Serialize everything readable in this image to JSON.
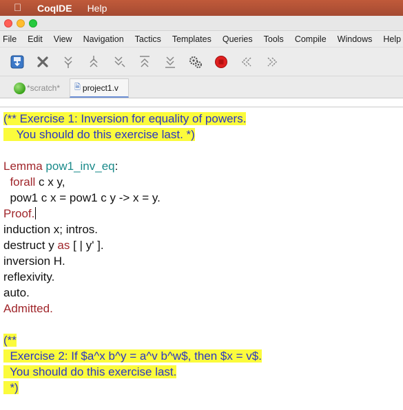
{
  "mac_menu": {
    "app_name": "CoqIDE",
    "help": "Help"
  },
  "menu": [
    "File",
    "Edit",
    "View",
    "Navigation",
    "Tactics",
    "Templates",
    "Queries",
    "Tools",
    "Compile",
    "Windows",
    "Help"
  ],
  "toolbar_icons": [
    "save-icon",
    "close-icon",
    "forward-one-icon",
    "backward-one-icon",
    "forward-to-cursor-icon",
    "backward-to-start-icon",
    "forward-to-end-icon",
    "broken-gears-icon",
    "interrupt-icon",
    "previous-occurrence-icon",
    "next-occurrence-icon"
  ],
  "tabs": {
    "scratch": "*scratch*",
    "project": "project1.v"
  },
  "code": {
    "ex1_a": "(** Exercise 1: Inversion for equality of powers.",
    "ex1_b": "    You should do this exercise last. *)",
    "lemma_kw": "Lemma",
    "lemma_name": "pow1_inv_eq",
    "lemma_colon": ":",
    "forall_kw": "forall",
    "forall_rest": " c x y,",
    "stmt": "  pow1 c x = pow1 c y -> x = y.",
    "proof": "Proof.",
    "t1": "induction x; intros.",
    "t2_a": "destruct y ",
    "t2_kw": "as",
    "t2_b": " [ | y' ].",
    "t3": "inversion H.",
    "t4": "reflexivity.",
    "t5": "auto.",
    "admitted": "Admitted.",
    "ex2_open": "(**",
    "ex2_a": "  Exercise 2: If $a^x b^y = a^v b^w$, then $x = v$.",
    "ex2_b": "  You should do this exercise last.",
    "ex2_close": "  *)"
  },
  "colors": {
    "comment": "#2a35c4",
    "keyword": "#a0262b",
    "identifier": "#1a8a8a",
    "highlight": "#fbfb3c"
  }
}
